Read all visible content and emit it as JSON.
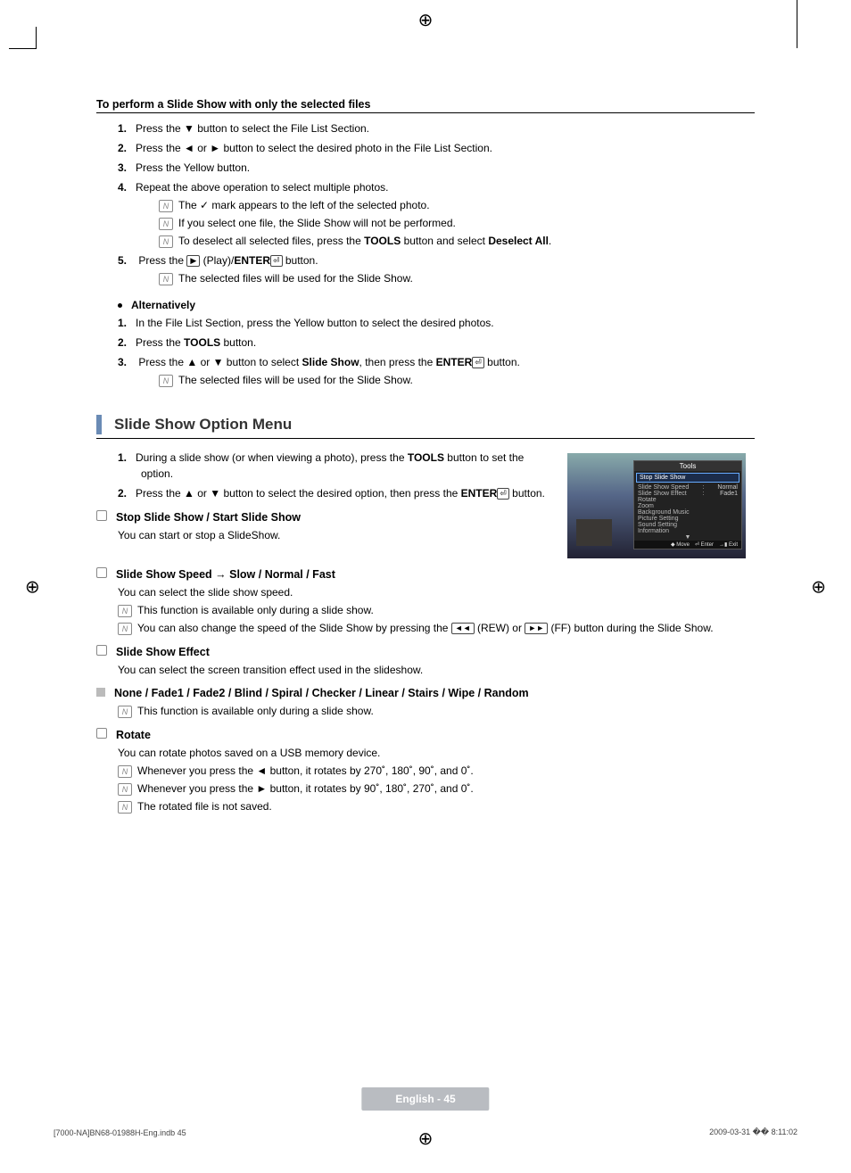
{
  "heading1": "To perform a Slide Show with only the selected files",
  "steps1": {
    "s1": {
      "n": "1.",
      "t1": "Press the ▼ button to select the File List Section."
    },
    "s2": {
      "n": "2.",
      "t1": "Press the ◄ or ► button to select the desired photo in the File List Section."
    },
    "s3": {
      "n": "3.",
      "t1": "Press the Yellow button."
    },
    "s4": {
      "n": "4.",
      "t1": "Repeat the above operation to select multiple photos.",
      "n1": "The ✓ mark appears to the left of the selected photo.",
      "n2": "If you select one file, the Slide Show will not be performed.",
      "n3a": "To deselect all selected files, press the ",
      "n3b": "TOOLS",
      "n3c": " button and select ",
      "n3d": "Deselect All",
      "n3e": "."
    },
    "s5": {
      "n": "5.",
      "t1a": "Press the ",
      "t1b": "▶",
      "t1c": " (Play)/",
      "t1d": "ENTER",
      "t1e": " button.",
      "n1": "The selected files will be used for the Slide Show."
    }
  },
  "alt_label": "Alternatively",
  "steps2": {
    "s1": {
      "n": "1.",
      "t1": "In the File List Section, press the Yellow button to select the desired photos."
    },
    "s2": {
      "n": "2.",
      "t1a": "Press the ",
      "t1b": "TOOLS",
      "t1c": " button."
    },
    "s3": {
      "n": "3.",
      "t1a": "Press the ▲ or ▼ button to select ",
      "t1b": "Slide Show",
      "t1c": ", then press the ",
      "t1d": "ENTER",
      "t1e": " button.",
      "n1": "The selected files will be used for the Slide Show."
    }
  },
  "h2": "Slide Show Option Menu",
  "opt_steps": {
    "s1": {
      "n": "1.",
      "t1a": "During a slide show (or when viewing a photo), press the ",
      "t1b": "TOOLS",
      "t1c": " button to set the option."
    },
    "s2": {
      "n": "2.",
      "t1a": "Press the ▲ or ▼ button to select the desired option, then press the ",
      "t1b": "ENTER",
      "t1c": " button."
    }
  },
  "sub1": {
    "t": "Stop Slide Show / Start Slide Show",
    "d": "You can start or stop a SlideShow."
  },
  "sub2": {
    "t": "Slide Show Speed → Slow / Normal / Fast",
    "d": "You can select the slide show speed.",
    "n1": "This function is available only during a slide show.",
    "n2a": "You can also change the speed of the Slide Show by pressing the ",
    "n2b": "◄◄",
    "n2c": " (REW) or ",
    "n2d": "►►",
    "n2e": " (FF) button during the Slide Show."
  },
  "sub3": {
    "t": "Slide Show Effect",
    "d": "You can select the screen transition effect used in the slideshow."
  },
  "sub3b": {
    "t": "None / Fade1 / Fade2 / Blind / Spiral / Checker / Linear / Stairs / Wipe / Random",
    "n1": "This function is available only during a slide show."
  },
  "sub4": {
    "t": "Rotate",
    "d": "You can rotate photos saved on a USB memory device.",
    "n1": "Whenever you press the ◄ button, it rotates by 270˚, 180˚, 90˚, and 0˚.",
    "n2": "Whenever you press the ► button, it rotates by 90˚, 180˚, 270˚, and 0˚.",
    "n3": "The rotated file is not saved."
  },
  "tools_panel": {
    "title": "Tools",
    "selected": "Stop Slide Show",
    "r1l": "Slide Show Speed",
    "r1r": "Normal",
    "r2l": "Slide Show Effect",
    "r2r": "Fade1",
    "i3": "Rotate",
    "i4": "Zoom",
    "i5": "Background Music",
    "i6": "Picture Setting",
    "i7": "Sound Setting",
    "i8": "Information",
    "f1": "Move",
    "f2": "Enter",
    "f3": "Exit"
  },
  "footer_label": "English - 45",
  "indb": "[7000-NA]BN68-01988H-Eng.indb   45",
  "date": "2009-03-31   �� 8:11:02"
}
